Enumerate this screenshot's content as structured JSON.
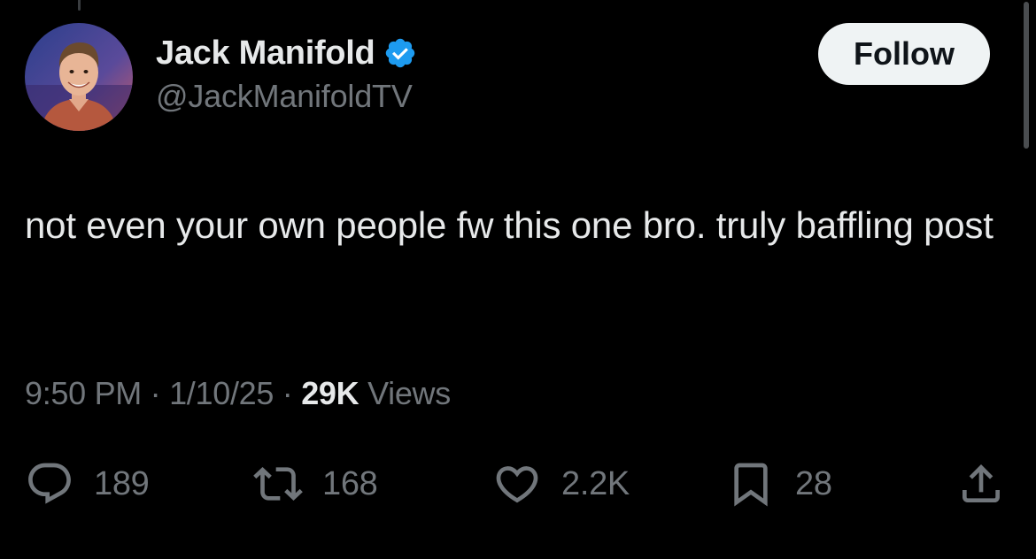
{
  "profile": {
    "display_name": "Jack Manifold",
    "handle": "@JackManifoldTV",
    "verified": true,
    "verified_icon": "verified-badge-icon",
    "follow_label": "Follow"
  },
  "tweet": {
    "text": "not even your own people fw this one bro. truly baffling post"
  },
  "meta": {
    "time": "9:50 PM",
    "separator": "·",
    "date": "1/10/25",
    "views_count": "29K",
    "views_label": "Views"
  },
  "actions": {
    "reply": {
      "icon": "reply-icon",
      "count": "189"
    },
    "retweet": {
      "icon": "retweet-icon",
      "count": "168"
    },
    "like": {
      "icon": "heart-icon",
      "count": "2.2K"
    },
    "bookmark": {
      "icon": "bookmark-icon",
      "count": "28"
    },
    "share": {
      "icon": "share-icon"
    }
  },
  "colors": {
    "background": "#000000",
    "primary_text": "#e7e9ea",
    "secondary_text": "#71767b",
    "verified_blue": "#1d9bf0",
    "follow_button_bg": "#eff3f4"
  }
}
